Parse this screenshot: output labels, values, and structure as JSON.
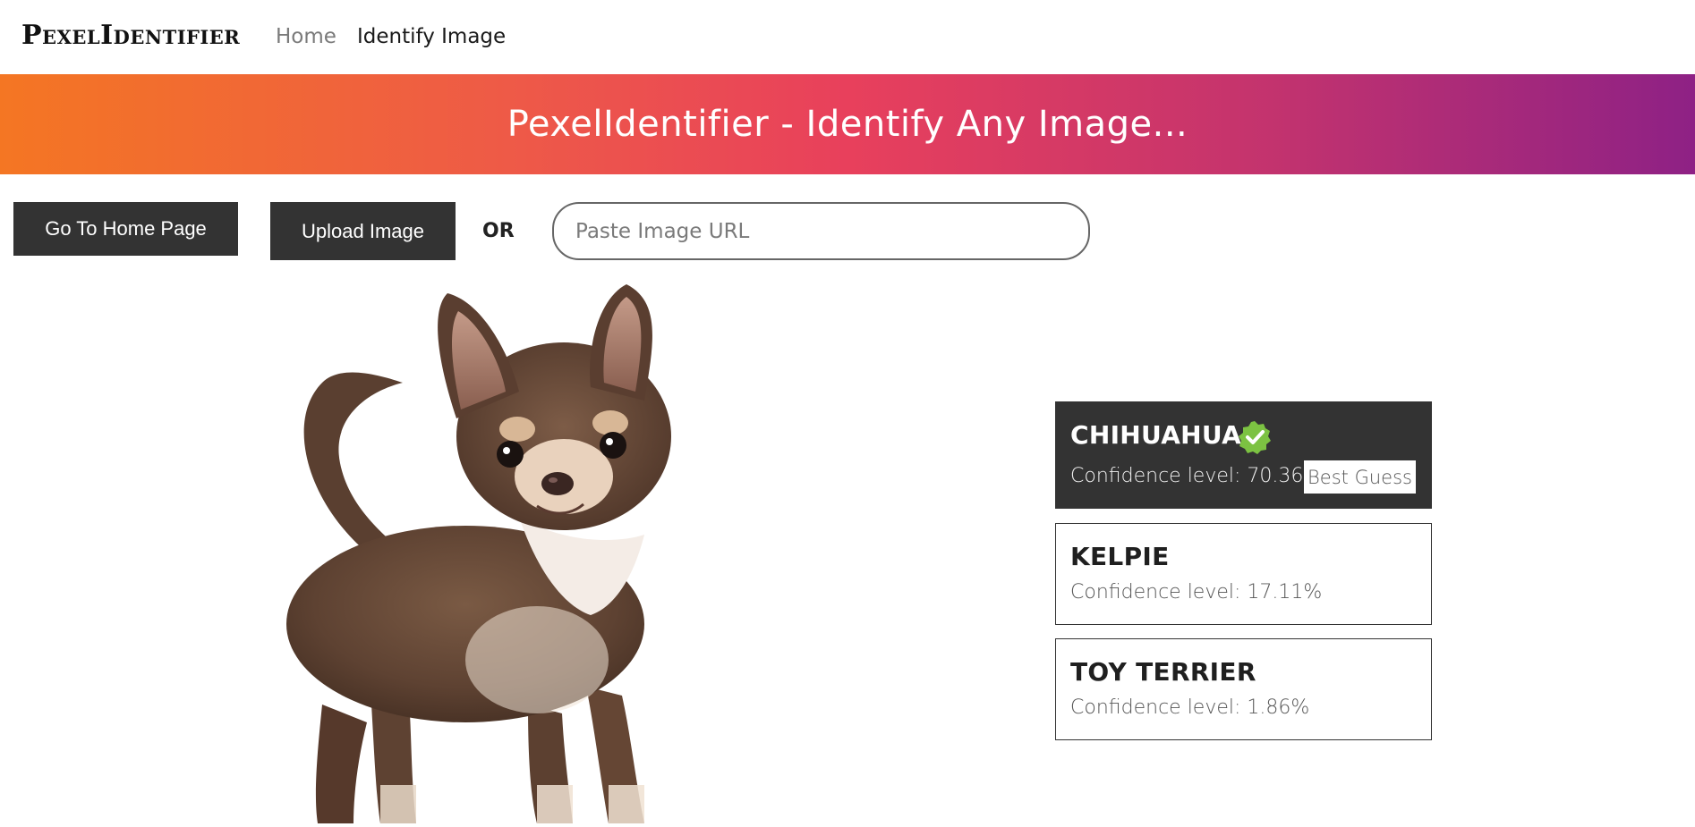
{
  "navbar": {
    "brand": "PexelIdentifier",
    "links": [
      {
        "label": "Home"
      },
      {
        "label": "Identify Image"
      }
    ]
  },
  "hero": {
    "title": "PexelIdentifier - Identify Any Image..."
  },
  "toolbar": {
    "home_button": "Go To Home Page",
    "upload_button": "Upload Image",
    "or_label": "OR",
    "url_placeholder": "Paste Image URL",
    "url_value": ""
  },
  "preview": {
    "subject": "chihuahua photo"
  },
  "results": [
    {
      "name": "CHIHUAHUA",
      "confidence": "Confidence level: 70.36%",
      "badge": "Best Guess",
      "best": true
    },
    {
      "name": "KELPIE",
      "confidence": "Confidence level: 17.11%"
    },
    {
      "name": "TOY TERRIER",
      "confidence": "Confidence level: 1.86%"
    }
  ],
  "colors": {
    "hero_gradient_start": "#f47623",
    "hero_gradient_mid": "#e8405c",
    "hero_gradient_end": "#8e2185",
    "dark_button": "#333333",
    "verified_green": "#7cc242"
  },
  "icons": {
    "best_guess_badge": "verified-check-icon"
  }
}
